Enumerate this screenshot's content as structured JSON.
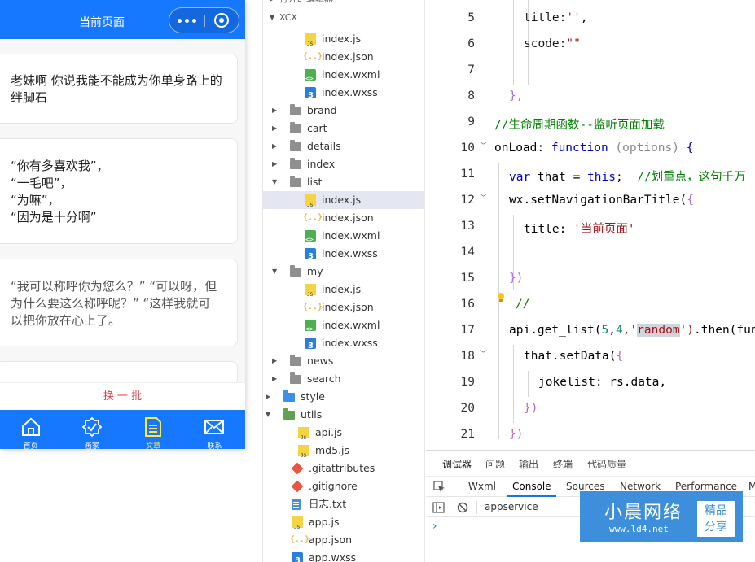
{
  "simulator": {
    "title": "当前页面",
    "jokes": [
      "老妹啊 你说我能不能成为你单身路上的绊脚石",
      "“你有多喜欢我”，\n“一毛吧”，\n“为嘛”，\n“因为是十分啊”",
      "“我可以称呼你为您么？” “可以呀，但为什么要这么称呼呢？” “这样我就可以把你放在心上了。"
    ],
    "refresh_label": "换 一 批",
    "tabs": [
      {
        "label": "首页",
        "icon": "home-icon"
      },
      {
        "label": "画家",
        "icon": "badge-icon"
      },
      {
        "label": "文章",
        "icon": "document-icon"
      },
      {
        "label": "联系",
        "icon": "mail-icon"
      }
    ],
    "colors": {
      "nav": "#1677ff",
      "tab_active": "#ffeb3b",
      "refresh": "#e64340"
    }
  },
  "explorer": {
    "header_fragment": "打开的编辑器",
    "project": "XCX",
    "files": [
      {
        "name": "index.js",
        "icon": "js"
      },
      {
        "name": "index.json",
        "icon": "json"
      },
      {
        "name": "index.wxml",
        "icon": "wxml"
      },
      {
        "name": "index.wxss",
        "icon": "wxss"
      },
      {
        "name": "brand",
        "icon": "folder"
      },
      {
        "name": "cart",
        "icon": "folder"
      },
      {
        "name": "details",
        "icon": "folder"
      },
      {
        "name": "index",
        "icon": "folder"
      },
      {
        "name": "list",
        "icon": "folder"
      },
      {
        "name": "index.js",
        "icon": "js"
      },
      {
        "name": "index.json",
        "icon": "json"
      },
      {
        "name": "index.wxml",
        "icon": "wxml"
      },
      {
        "name": "index.wxss",
        "icon": "wxss"
      },
      {
        "name": "my",
        "icon": "folder"
      },
      {
        "name": "index.js",
        "icon": "js"
      },
      {
        "name": "index.json",
        "icon": "json"
      },
      {
        "name": "index.wxml",
        "icon": "wxml"
      },
      {
        "name": "index.wxss",
        "icon": "wxss"
      },
      {
        "name": "news",
        "icon": "folder"
      },
      {
        "name": "search",
        "icon": "folder"
      },
      {
        "name": "style",
        "icon": "folder-blue"
      },
      {
        "name": "utils",
        "icon": "folder-green"
      },
      {
        "name": "api.js",
        "icon": "js"
      },
      {
        "name": "md5.js",
        "icon": "js"
      },
      {
        "name": ".gitattributes",
        "icon": "git"
      },
      {
        "name": ".gitignore",
        "icon": "git"
      },
      {
        "name": "日志.txt",
        "icon": "txt"
      },
      {
        "name": "app.js",
        "icon": "js"
      },
      {
        "name": "app.json",
        "icon": "json"
      },
      {
        "name": "app.wxss",
        "icon": "wxss"
      }
    ]
  },
  "editor": {
    "line_numbers": [
      "5",
      "6",
      "7",
      "8",
      "9",
      "10",
      "11",
      "12",
      "13",
      "14",
      "15",
      "16",
      "17",
      "18",
      "19",
      "20",
      "21"
    ],
    "lines": {
      "l5a": "title:",
      "l5b": "''",
      "l5c": ",",
      "l6a": "scode:",
      "l6b": "\"\"",
      "l8": "},",
      "l9": "//生命周期函数--监听页面加载",
      "l10a": "onLoad: ",
      "l10b": "function",
      "l10c": " (options)",
      "l10d": " {",
      "l11a": "var",
      "l11b": " that = ",
      "l11c": "this",
      "l11d": ";  ",
      "l11e": "//划重点，这句千万",
      "l12a": "wx.setNavigationBarTitle(",
      "l12b": "{",
      "l13a": "title: ",
      "l13b": "'当前页面'",
      "l15": "})",
      "l16": "//",
      "l17a": "api.get_list(",
      "l17b": "5",
      "l17c": ",",
      "l17d": "4",
      "l17e": ",'",
      "l17f": "random",
      "l17g": "')",
      "l17h": ".then(fun",
      "l18a": "that.setData(",
      "l18b": "{",
      "l19": "jokelist: rs.data,",
      "l20": "})",
      "l21": "})"
    }
  },
  "panel": {
    "tabs": [
      "调试器",
      "问题",
      "输出",
      "终端",
      "代码质量"
    ],
    "devtools_tabs": [
      "Wxml",
      "Console",
      "Sources",
      "Network",
      "Performance",
      "M"
    ],
    "context": "appservice",
    "prompt": "›"
  },
  "watermark": {
    "brand": "小晨网络",
    "url": "www.ld4.net",
    "badge_line1": "精品",
    "badge_line2": "分享"
  }
}
